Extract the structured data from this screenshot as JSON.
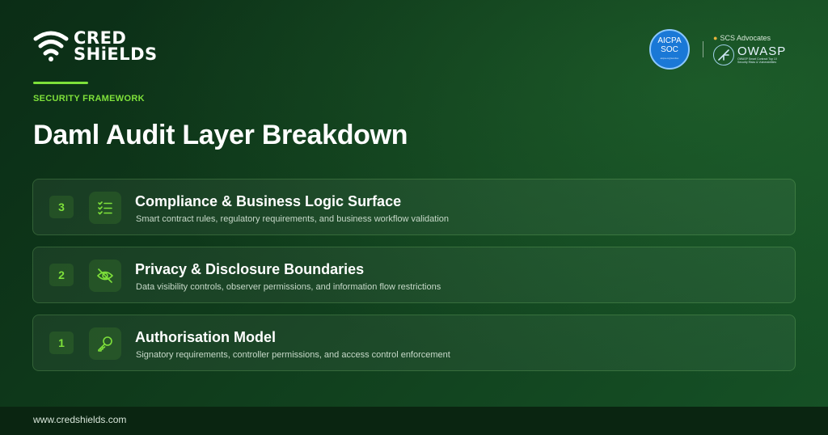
{
  "brand": {
    "logo_line1": "CRED",
    "logo_line2": "SHiELDS"
  },
  "badges": {
    "aicpa_line1": "AICPA",
    "aicpa_line2": "SOC",
    "aicpa_small": "aicpa.org/soc4so",
    "scs_label": "SCS Advocates",
    "owasp_word": "OWASP",
    "owasp_tagline": "OWASP Smart Contract Top 10 Security Risks & Vulnerabilities"
  },
  "kicker": "SECURITY FRAMEWORK",
  "title": "Daml Audit Layer Breakdown",
  "layers": [
    {
      "number": "3",
      "icon": "checklist-icon",
      "title": "Compliance & Business Logic Surface",
      "description": "Smart contract rules, regulatory requirements, and business workflow validation"
    },
    {
      "number": "2",
      "icon": "eye-off-icon",
      "title": "Privacy & Disclosure Boundaries",
      "description": "Data visibility controls, observer permissions, and information flow restrictions"
    },
    {
      "number": "1",
      "icon": "key-icon",
      "title": "Authorisation Model",
      "description": "Signatory requirements, controller permissions, and access control enforcement"
    }
  ],
  "footer": {
    "url": "www.credshields.com"
  },
  "colors": {
    "accent": "#7ee03a",
    "background": "#0f3a1b",
    "footer": "#0a2511"
  }
}
